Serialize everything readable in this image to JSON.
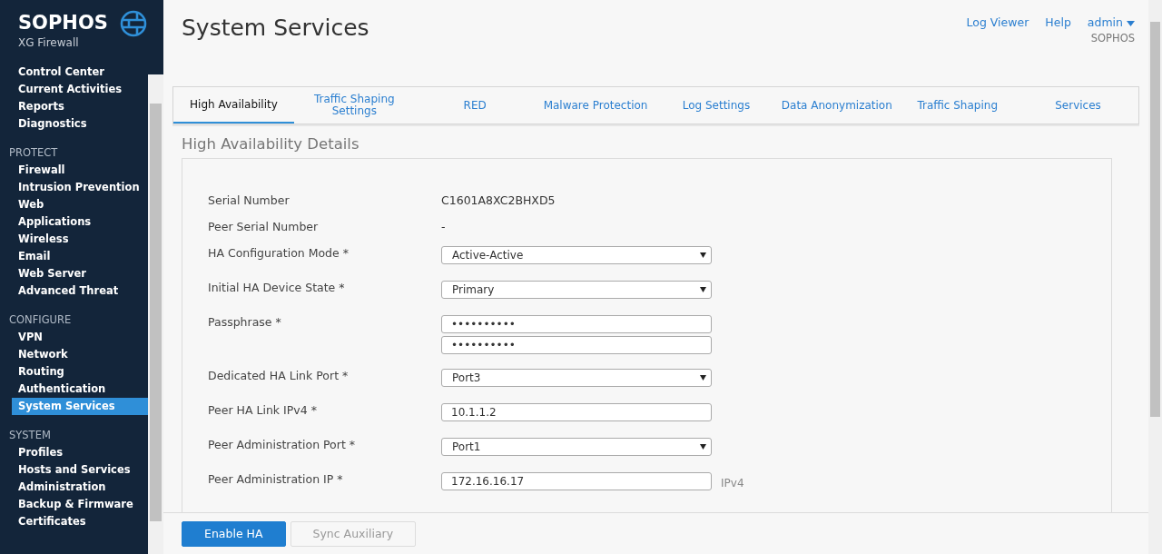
{
  "brand": {
    "name": "SOPHOS",
    "product": "XG Firewall"
  },
  "sidebar": {
    "sections": [
      {
        "items": [
          {
            "label": "Control Center",
            "selected": false
          },
          {
            "label": "Current Activities",
            "selected": false
          },
          {
            "label": "Reports",
            "selected": false
          },
          {
            "label": "Diagnostics",
            "selected": false
          }
        ]
      },
      {
        "heading": "PROTECT",
        "items": [
          {
            "label": "Firewall",
            "selected": false
          },
          {
            "label": "Intrusion Prevention",
            "selected": false
          },
          {
            "label": "Web",
            "selected": false
          },
          {
            "label": "Applications",
            "selected": false
          },
          {
            "label": "Wireless",
            "selected": false
          },
          {
            "label": "Email",
            "selected": false
          },
          {
            "label": "Web Server",
            "selected": false
          },
          {
            "label": "Advanced Threat",
            "selected": false
          }
        ]
      },
      {
        "heading": "CONFIGURE",
        "items": [
          {
            "label": "VPN",
            "selected": false
          },
          {
            "label": "Network",
            "selected": false
          },
          {
            "label": "Routing",
            "selected": false
          },
          {
            "label": "Authentication",
            "selected": false
          },
          {
            "label": "System Services",
            "selected": true
          }
        ]
      },
      {
        "heading": "SYSTEM",
        "items": [
          {
            "label": "Profiles",
            "selected": false
          },
          {
            "label": "Hosts and Services",
            "selected": false
          },
          {
            "label": "Administration",
            "selected": false
          },
          {
            "label": "Backup & Firmware",
            "selected": false
          },
          {
            "label": "Certificates",
            "selected": false
          }
        ]
      }
    ]
  },
  "page_title": "System Services",
  "top_links": [
    "Log Viewer",
    "Help"
  ],
  "user": {
    "name": "admin",
    "org": "SOPHOS"
  },
  "tabs": [
    {
      "label": "High Availability",
      "selected": true
    },
    {
      "label": "Traffic Shaping Settings",
      "selected": false
    },
    {
      "label": "RED",
      "selected": false
    },
    {
      "label": "Malware Protection",
      "selected": false
    },
    {
      "label": "Log Settings",
      "selected": false
    },
    {
      "label": "Data Anonymization",
      "selected": false
    },
    {
      "label": "Traffic Shaping",
      "selected": false
    },
    {
      "label": "Services",
      "selected": false
    }
  ],
  "section_title": "High Availability Details",
  "fields": [
    {
      "kind": "static",
      "label": "Serial Number",
      "value": "C1601A8XC2BHXD5"
    },
    {
      "kind": "static",
      "label": "Peer Serial Number",
      "value": "-"
    },
    {
      "kind": "select",
      "label": "HA Configuration Mode *",
      "value": "Active-Active"
    },
    {
      "kind": "select",
      "label": "Initial HA Device State *",
      "value": "Primary"
    },
    {
      "kind": "password",
      "label": "Passphrase *",
      "values": [
        "••••••••••",
        "••••••••••"
      ]
    },
    {
      "kind": "select",
      "label": "Dedicated HA Link Port *",
      "value": "Port3"
    },
    {
      "kind": "input",
      "label": "Peer HA Link IPv4 *",
      "value": "10.1.1.2"
    },
    {
      "kind": "select",
      "label": "Peer Administration Port *",
      "value": "Port1"
    },
    {
      "kind": "input",
      "label": "Peer Administration IP *",
      "value": "172.16.16.17",
      "hint": "IPv4"
    }
  ],
  "buttons": [
    {
      "label": "Enable HA",
      "disabled": false
    },
    {
      "label": "Sync Auxiliary",
      "disabled": true
    }
  ]
}
